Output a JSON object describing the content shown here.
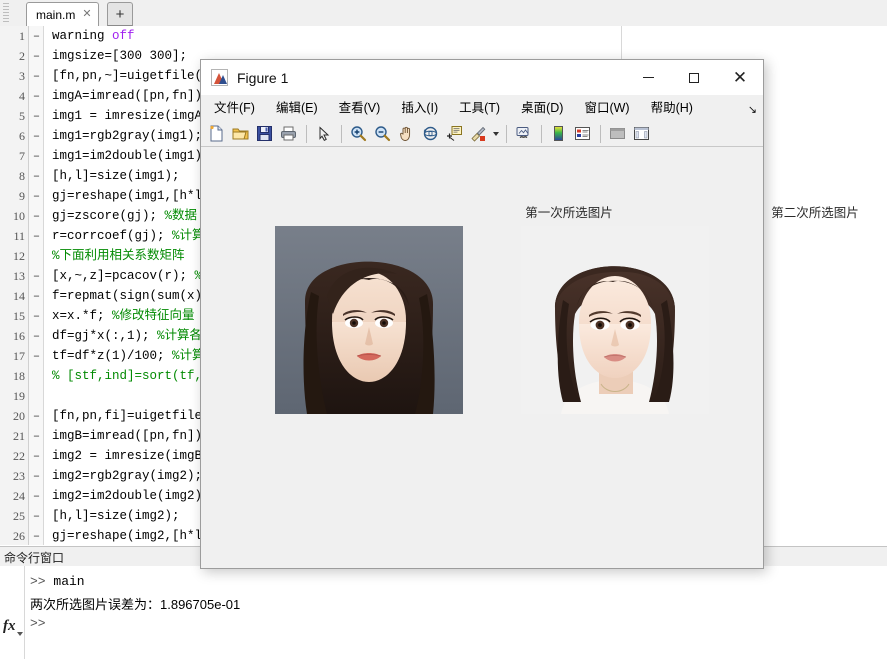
{
  "editor": {
    "tab": {
      "label": "main.m",
      "close_icon": "close-icon",
      "new_tab_label": "+"
    },
    "code_lines": [
      {
        "num": "1",
        "dash": "–",
        "segments": [
          {
            "t": "warning ",
            "c": "plain"
          },
          {
            "t": "off",
            "c": "kwd"
          }
        ]
      },
      {
        "num": "2",
        "dash": "–",
        "segments": [
          {
            "t": "imgsize=[300 300];",
            "c": "plain"
          }
        ]
      },
      {
        "num": "3",
        "dash": "–",
        "segments": [
          {
            "t": "[fn,pn,~]=uigetfile(",
            "c": "plain"
          }
        ]
      },
      {
        "num": "4",
        "dash": "–",
        "segments": [
          {
            "t": "imgA=imread([pn,fn])",
            "c": "plain"
          }
        ]
      },
      {
        "num": "5",
        "dash": "–",
        "segments": [
          {
            "t": "img1 = imresize(imgA",
            "c": "plain"
          }
        ]
      },
      {
        "num": "6",
        "dash": "–",
        "segments": [
          {
            "t": "img1=rgb2gray(img1);",
            "c": "plain"
          }
        ]
      },
      {
        "num": "7",
        "dash": "–",
        "segments": [
          {
            "t": "img1=im2double(img1)",
            "c": "plain"
          }
        ]
      },
      {
        "num": "8",
        "dash": "–",
        "segments": [
          {
            "t": "[h,l]=size(img1);",
            "c": "plain"
          }
        ]
      },
      {
        "num": "9",
        "dash": "–",
        "segments": [
          {
            "t": "gj=reshape(img1,[h*l",
            "c": "plain"
          }
        ]
      },
      {
        "num": "10",
        "dash": "–",
        "segments": [
          {
            "t": "gj=zscore(gj); ",
            "c": "plain"
          },
          {
            "t": "%数据",
            "c": "cm"
          }
        ]
      },
      {
        "num": "11",
        "dash": "–",
        "segments": [
          {
            "t": "r=corrcoef(gj); ",
            "c": "plain"
          },
          {
            "t": "%计算",
            "c": "cm"
          }
        ]
      },
      {
        "num": "12",
        "dash": "",
        "segments": [
          {
            "t": "%下面利用相关系数矩阵",
            "c": "cm"
          }
        ]
      },
      {
        "num": "13",
        "dash": "–",
        "segments": [
          {
            "t": "[x,~,z]=pcacov(r); ",
            "c": "plain"
          },
          {
            "t": "%",
            "c": "cm"
          }
        ]
      },
      {
        "num": "14",
        "dash": "–",
        "segments": [
          {
            "t": "f=repmat(sign(sum(x)",
            "c": "plain"
          }
        ]
      },
      {
        "num": "15",
        "dash": "–",
        "segments": [
          {
            "t": "x=x.*f; ",
            "c": "plain"
          },
          {
            "t": "%修改特征向量",
            "c": "cm"
          }
        ]
      },
      {
        "num": "16",
        "dash": "–",
        "segments": [
          {
            "t": "df=gj*x(:,1); ",
            "c": "plain"
          },
          {
            "t": "%计算各",
            "c": "cm"
          }
        ]
      },
      {
        "num": "17",
        "dash": "–",
        "segments": [
          {
            "t": "tf=df*z(1)/100; ",
            "c": "plain"
          },
          {
            "t": "%计算",
            "c": "cm"
          }
        ]
      },
      {
        "num": "18",
        "dash": "",
        "segments": [
          {
            "t": "% [stf,ind]=sort(tf,",
            "c": "cm"
          }
        ]
      },
      {
        "num": "19",
        "dash": "",
        "segments": [
          {
            "t": "",
            "c": "plain"
          }
        ]
      },
      {
        "num": "20",
        "dash": "–",
        "segments": [
          {
            "t": "[fn,pn,fi]=uigetfile",
            "c": "plain"
          }
        ]
      },
      {
        "num": "21",
        "dash": "–",
        "segments": [
          {
            "t": "imgB=imread([pn,fn])",
            "c": "plain"
          }
        ]
      },
      {
        "num": "22",
        "dash": "–",
        "segments": [
          {
            "t": "img2 = imresize(imgB",
            "c": "plain"
          }
        ]
      },
      {
        "num": "23",
        "dash": "–",
        "segments": [
          {
            "t": "img2=rgb2gray(img2);",
            "c": "plain"
          }
        ]
      },
      {
        "num": "24",
        "dash": "–",
        "segments": [
          {
            "t": "img2=im2double(img2)",
            "c": "plain"
          }
        ]
      },
      {
        "num": "25",
        "dash": "–",
        "segments": [
          {
            "t": "[h,l]=size(img2);",
            "c": "plain"
          }
        ]
      },
      {
        "num": "26",
        "dash": "–",
        "segments": [
          {
            "t": "gj=reshape(img2,[h*l",
            "c": "plain"
          }
        ]
      }
    ]
  },
  "command_window": {
    "header": "命令行窗口",
    "fx_label": "fx",
    "lines": [
      {
        "prompt": ">> ",
        "text": "main",
        "cn": false
      },
      {
        "prompt": "",
        "text": "两次所选图片误差为：1.896705e-01",
        "cn": true
      },
      {
        "prompt": ">> ",
        "text": "",
        "cn": false
      }
    ]
  },
  "figure": {
    "title": "Figure 1",
    "icon": "matlab-figure-icon",
    "window_buttons": {
      "minimize": "minimize-icon",
      "maximize": "maximize-icon",
      "close": "✕"
    },
    "menu": [
      {
        "label": "文件(F)",
        "name": "menu-file"
      },
      {
        "label": "编辑(E)",
        "name": "menu-edit"
      },
      {
        "label": "查看(V)",
        "name": "menu-view"
      },
      {
        "label": "插入(I)",
        "name": "menu-insert"
      },
      {
        "label": "工具(T)",
        "name": "menu-tools"
      },
      {
        "label": "桌面(D)",
        "name": "menu-desktop"
      },
      {
        "label": "窗口(W)",
        "name": "menu-window"
      },
      {
        "label": "帮助(H)",
        "name": "menu-help"
      }
    ],
    "menu_overflow": "↘",
    "toolbar": [
      {
        "name": "new-figure-icon",
        "kind": "page"
      },
      {
        "name": "open-file-icon",
        "kind": "folder"
      },
      {
        "name": "save-figure-icon",
        "kind": "save"
      },
      {
        "name": "print-figure-icon",
        "kind": "print"
      },
      {
        "name": "separator",
        "kind": "sep"
      },
      {
        "name": "edit-plot-arrow-icon",
        "kind": "arrow"
      },
      {
        "name": "separator",
        "kind": "sep"
      },
      {
        "name": "zoom-in-icon",
        "kind": "zoomin"
      },
      {
        "name": "zoom-out-icon",
        "kind": "zoomout"
      },
      {
        "name": "pan-hand-icon",
        "kind": "hand"
      },
      {
        "name": "rotate-3d-icon",
        "kind": "rotate"
      },
      {
        "name": "data-cursor-icon",
        "kind": "datatip"
      },
      {
        "name": "brush-icon",
        "kind": "brush"
      },
      {
        "name": "brush-dropdown-caret",
        "kind": "caret"
      },
      {
        "name": "separator",
        "kind": "sep"
      },
      {
        "name": "link-plot-icon",
        "kind": "link"
      },
      {
        "name": "separator",
        "kind": "sep"
      },
      {
        "name": "colorbar-icon",
        "kind": "colorbar"
      },
      {
        "name": "legend-icon",
        "kind": "legend"
      },
      {
        "name": "separator",
        "kind": "sep"
      },
      {
        "name": "hide-plot-tools-icon",
        "kind": "hidetools"
      },
      {
        "name": "show-plot-tools-icon",
        "kind": "showtools"
      }
    ],
    "plots": [
      {
        "name": "plot-left",
        "title": "第一次所选图片",
        "image": "portrait-photo-1"
      },
      {
        "name": "plot-right",
        "title": "第二次所选图片",
        "image": "portrait-photo-2"
      }
    ]
  },
  "colors": {
    "keyword_purple": "#a020f0",
    "comment_green": "#028a02",
    "figure_bg": "#f0f0f0",
    "chrome_gray": "#f0f0f0"
  }
}
